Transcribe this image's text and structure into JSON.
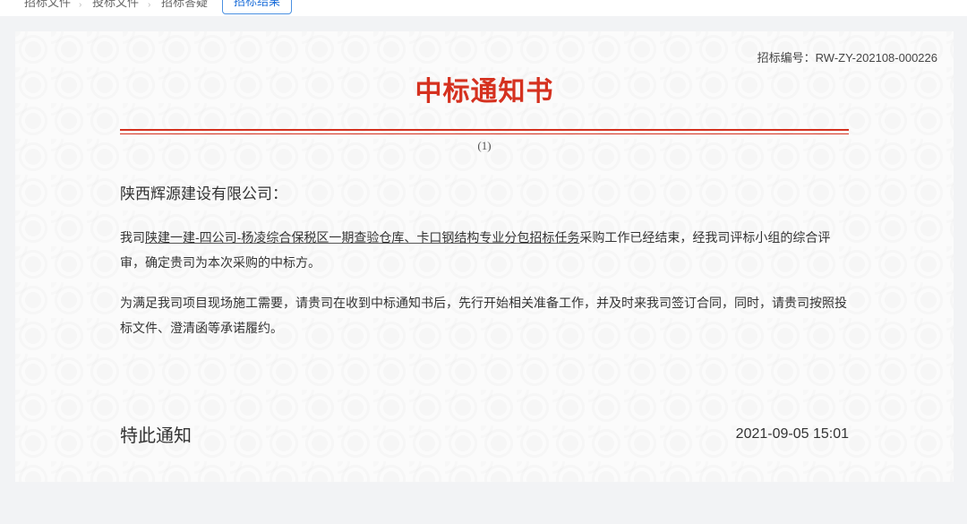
{
  "tabs": [
    {
      "label": "招标文件"
    },
    {
      "label": "投标文件"
    },
    {
      "label": "招标答疑"
    },
    {
      "label": "招标结果"
    }
  ],
  "notice": {
    "bid_number_label": "招标编号：",
    "bid_number": "RW-ZY-202108-000226",
    "title": "中标通知书",
    "sequence": "(1)",
    "recipient": "陕西辉源建设有限公司：",
    "para1_prefix": "我司",
    "para1_project": "陕建一建-四公司-杨凌综合保税区一期查验仓库、卡口钢结构专业分包招标任务",
    "para1_suffix": "采购工作已经结束，经我司评标小组的综合评审，确定贵司为本次采购的中标方。",
    "para2": "为满足我司项目现场施工需要，请贵司在收到中标通知书后，先行开始相关准备工作，并及时来我司签订合同，同时，请贵司按照投标文件、澄清函等承诺履约。",
    "closing": "特此通知",
    "datetime": "2021-09-05 15:01"
  },
  "colors": {
    "accent_red": "#d5311f",
    "active_tab_border": "#4a90e2"
  }
}
